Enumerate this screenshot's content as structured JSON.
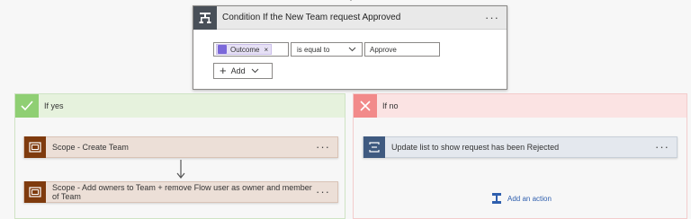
{
  "condition": {
    "title": "Condition If the New Team request Approved",
    "menu": "···",
    "token_label": "Outcome",
    "token_remove": "×",
    "operator": "is equal to",
    "value": "Approve",
    "add_label": "Add"
  },
  "branch_yes": {
    "label": "If yes",
    "actions": [
      {
        "title": "Scope - Create Team",
        "menu": "···"
      },
      {
        "title": "Scope - Add owners to Team + remove Flow user as owner and member of Team",
        "menu": "···"
      }
    ]
  },
  "branch_no": {
    "label": "If no",
    "action": {
      "title": "Update list to show request has been Rejected",
      "menu": "···"
    },
    "add_action_label": "Add an action"
  },
  "colors": {
    "yes_accent": "#8fcf73",
    "no_accent": "#f28a8a",
    "scope_icon": "#7f3b0e",
    "sharepoint_icon": "#3f5a80",
    "condition_icon": "#484f58",
    "link": "#2f5fae"
  },
  "icons": {
    "condition": "condition-icon",
    "token": "dynamic-content-icon",
    "yes": "check-icon",
    "no": "x-icon",
    "scope": "scope-icon",
    "sharepoint": "sharepoint-list-icon",
    "add_action": "add-action-icon"
  }
}
